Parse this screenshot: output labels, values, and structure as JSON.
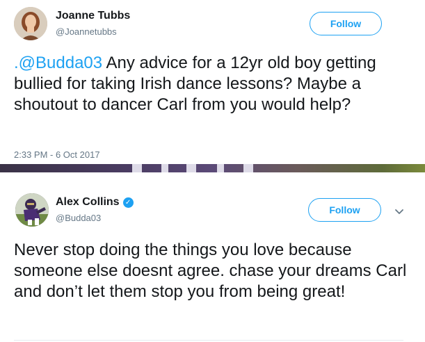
{
  "tweets": [
    {
      "name": "Joanne Tubbs",
      "handle": "@Joannetubbs",
      "follow_label": "Follow",
      "text_mention": ".@Budda03",
      "text_body": " Any advice for a 12yr old boy getting bullied for taking Irish dance lessons? Maybe a shoutout to dancer Carl from you would help?",
      "timestamp": "2:33 PM - 6 Oct 2017"
    },
    {
      "name": "Alex Collins",
      "verified": true,
      "handle": "@Budda03",
      "follow_label": "Follow",
      "text_body": "Never stop doing the things you love because someone else doesnt agree. chase your dreams Carl and don’t let them stop you from being great!"
    }
  ],
  "colors": {
    "accent": "#1da1f2",
    "muted": "#657786",
    "text": "#14171a"
  },
  "icons": {
    "verified": "verified-badge-icon",
    "more": "chevron-down-icon"
  }
}
